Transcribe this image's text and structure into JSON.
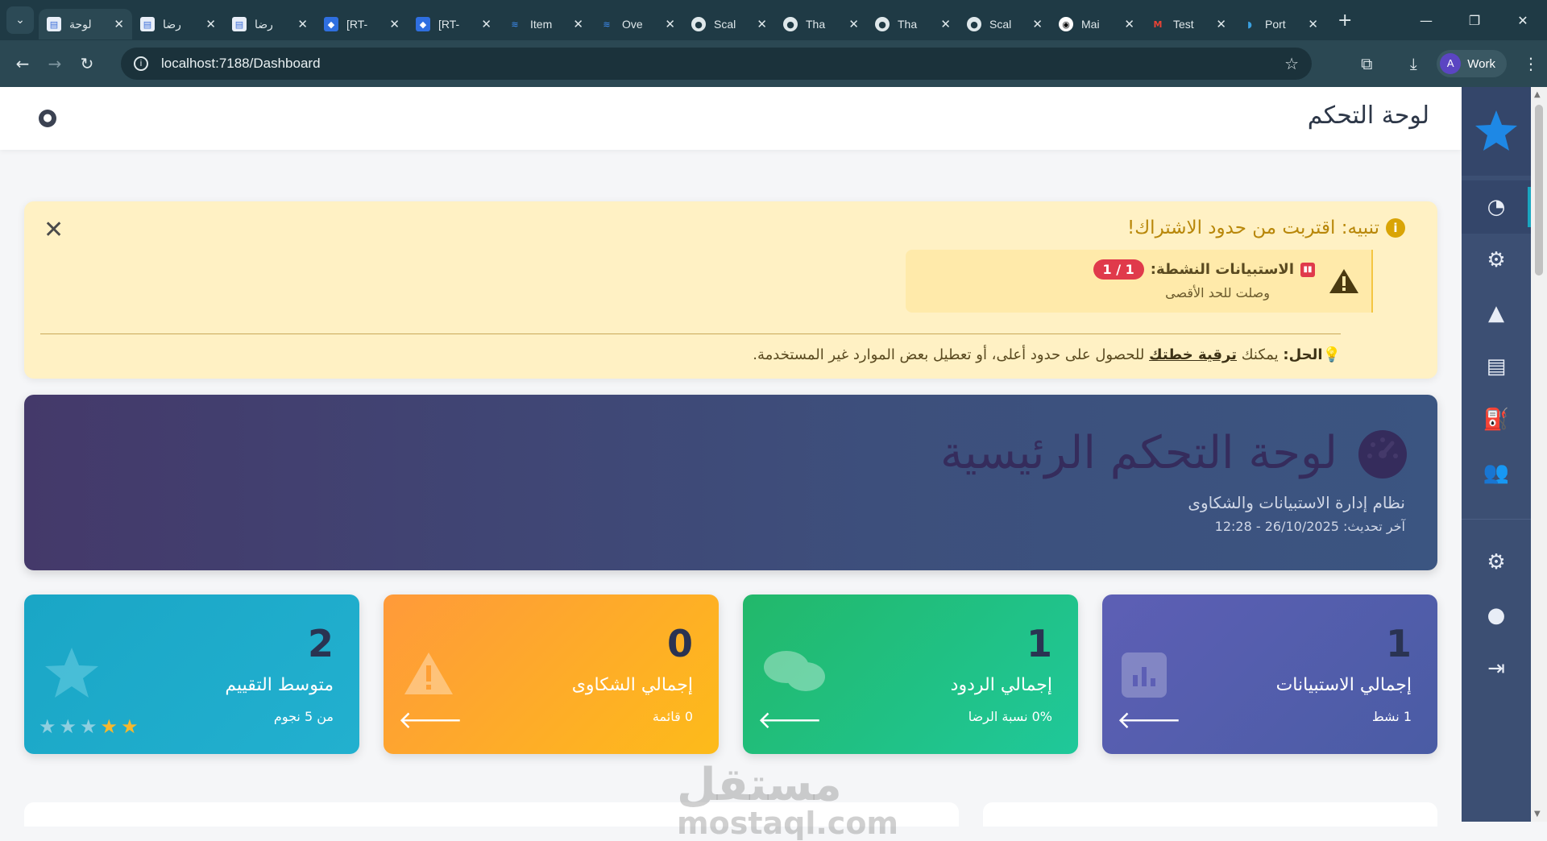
{
  "browser": {
    "tabs": [
      {
        "title": "لوحة",
        "icon": "document-icon",
        "active": true
      },
      {
        "title": "رضا",
        "icon": "document-icon"
      },
      {
        "title": "رضا",
        "icon": "document-icon"
      },
      {
        "title": "[RT-",
        "icon": "jira-icon"
      },
      {
        "title": "[RT-",
        "icon": "jira-icon"
      },
      {
        "title": "Item",
        "icon": "wave-icon"
      },
      {
        "title": "Ove",
        "icon": "wave-icon"
      },
      {
        "title": "Scal",
        "icon": "globe-icon"
      },
      {
        "title": "Tha",
        "icon": "globe-icon"
      },
      {
        "title": "Tha",
        "icon": "globe-icon"
      },
      {
        "title": "Scal",
        "icon": "globe-icon"
      },
      {
        "title": "Mai",
        "icon": "github-icon"
      },
      {
        "title": "Test",
        "icon": "gmail-icon"
      },
      {
        "title": "Port",
        "icon": "portal-icon"
      }
    ],
    "url": "localhost:7188/Dashboard",
    "profile_initial": "A",
    "profile_label": "Work"
  },
  "header": {
    "title": "لوحة التحكم"
  },
  "alert": {
    "title": "تنبيه: اقتربت من حدود الاشتراك!",
    "limit_label": "الاستبيانات النشطة:",
    "limit_badge": "1 / 1",
    "limit_note": "وصلت للحد الأقصى",
    "solution_prefix": "الحل:",
    "solution_text1": " يمكنك ",
    "solution_link": "ترقية خطتك",
    "solution_text2": " للحصول على حدود أعلى، أو تعطيل بعض الموارد غير المستخدمة."
  },
  "hero": {
    "title": "لوحة التحكم الرئيسية",
    "subtitle": "نظام إدارة الاستبيانات والشكاوى",
    "updated": "آخر تحديث: 26/10/2025 - 12:28"
  },
  "cards": [
    {
      "value": "1",
      "label": "إجمالي الاستبيانات",
      "meta": "1 نشط",
      "icon": "bar-chart-icon",
      "color": "#5d5fb5"
    },
    {
      "value": "1",
      "label": "إجمالي الردود",
      "meta": "0% نسبة الرضا",
      "icon": "comments-icon",
      "color": "#22b86a"
    },
    {
      "value": "0",
      "label": "إجمالي الشكاوى",
      "meta": "0 قائمة",
      "icon": "warning-icon",
      "color": "#ff9a3a"
    },
    {
      "value": "2",
      "label": "متوسط التقييم",
      "meta": "من 5 نجوم",
      "icon": "star-icon",
      "color": "#1aa6c6",
      "rating": 2
    }
  ],
  "sidebar": {
    "items": [
      "dashboard-icon",
      "cogs-icon",
      "warning-icon",
      "report-icon",
      "fuel-icon",
      "users-icon"
    ],
    "bottom": [
      "settings-icon",
      "user-icon",
      "logout-icon"
    ],
    "accent": "#19a6c0"
  },
  "watermark": {
    "arabic": "مستقل",
    "latin": "mostaql.com"
  }
}
